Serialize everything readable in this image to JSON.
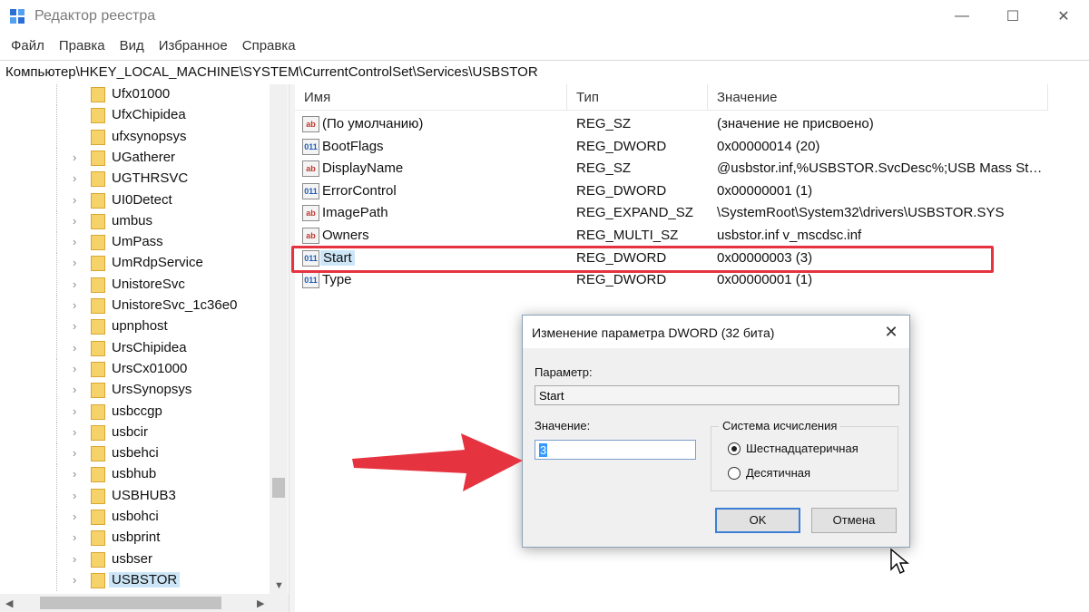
{
  "window": {
    "title": "Редактор реестра",
    "icon": "regedit-icon",
    "controls": {
      "minimize": "—",
      "maximize": "☐",
      "close": "✕"
    }
  },
  "menu": [
    "Файл",
    "Правка",
    "Вид",
    "Избранное",
    "Справка"
  ],
  "address": "Компьютер\\HKEY_LOCAL_MACHINE\\SYSTEM\\CurrentControlSet\\Services\\USBSTOR",
  "tree": {
    "items": [
      {
        "label": "Ufx01000",
        "expandable": false
      },
      {
        "label": "UfxChipidea",
        "expandable": false
      },
      {
        "label": "ufxsynopsys",
        "expandable": false
      },
      {
        "label": "UGatherer",
        "expandable": true
      },
      {
        "label": "UGTHRSVC",
        "expandable": true
      },
      {
        "label": "UI0Detect",
        "expandable": true
      },
      {
        "label": "umbus",
        "expandable": true
      },
      {
        "label": "UmPass",
        "expandable": true
      },
      {
        "label": "UmRdpService",
        "expandable": true
      },
      {
        "label": "UnistoreSvc",
        "expandable": true
      },
      {
        "label": "UnistoreSvc_1c36e0",
        "expandable": true
      },
      {
        "label": "upnphost",
        "expandable": true
      },
      {
        "label": "UrsChipidea",
        "expandable": true
      },
      {
        "label": "UrsCx01000",
        "expandable": true
      },
      {
        "label": "UrsSynopsys",
        "expandable": true
      },
      {
        "label": "usbccgp",
        "expandable": true
      },
      {
        "label": "usbcir",
        "expandable": true
      },
      {
        "label": "usbehci",
        "expandable": true
      },
      {
        "label": "usbhub",
        "expandable": true
      },
      {
        "label": "USBHUB3",
        "expandable": true
      },
      {
        "label": "usbohci",
        "expandable": true
      },
      {
        "label": "usbprint",
        "expandable": true
      },
      {
        "label": "usbser",
        "expandable": true
      },
      {
        "label": "USBSTOR",
        "expandable": true,
        "selected": true
      }
    ]
  },
  "list": {
    "columns": [
      "Имя",
      "Тип",
      "Значение"
    ],
    "rows": [
      {
        "icon": "ab",
        "name": "(По умолчанию)",
        "type": "REG_SZ",
        "data": "(значение не присвоено)"
      },
      {
        "icon": "dw",
        "name": "BootFlags",
        "type": "REG_DWORD",
        "data": "0x00000014 (20)"
      },
      {
        "icon": "ab",
        "name": "DisplayName",
        "type": "REG_SZ",
        "data": "@usbstor.inf,%USBSTOR.SvcDesc%;USB Mass Stor..."
      },
      {
        "icon": "dw",
        "name": "ErrorControl",
        "type": "REG_DWORD",
        "data": "0x00000001 (1)"
      },
      {
        "icon": "ab",
        "name": "ImagePath",
        "type": "REG_EXPAND_SZ",
        "data": "\\SystemRoot\\System32\\drivers\\USBSTOR.SYS"
      },
      {
        "icon": "ab",
        "name": "Owners",
        "type": "REG_MULTI_SZ",
        "data": "usbstor.inf v_mscdsc.inf"
      },
      {
        "icon": "dw",
        "name": "Start",
        "type": "REG_DWORD",
        "data": "0x00000003 (3)",
        "selected": true
      },
      {
        "icon": "dw",
        "name": "Type",
        "type": "REG_DWORD",
        "data": "0x00000001 (1)"
      }
    ]
  },
  "dialog": {
    "title": "Изменение параметра DWORD (32 бита)",
    "close": "✕",
    "param_label": "Параметр:",
    "param_value": "Start",
    "value_label": "Значение:",
    "value": "3",
    "base_group": "Система исчисления",
    "radio_hex": "Шестнадцатеричная",
    "radio_dec": "Десятичная",
    "selected_base": "hex",
    "ok": "OK",
    "cancel": "Отмена"
  },
  "colors": {
    "highlight": "#e5333f",
    "selection": "#cde6f7",
    "folder": "#f6d36a"
  }
}
